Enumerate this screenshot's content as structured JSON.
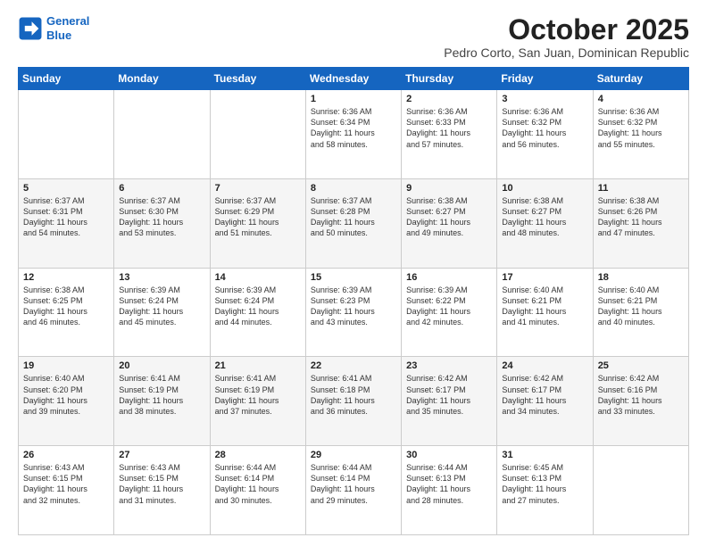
{
  "header": {
    "logo_line1": "General",
    "logo_line2": "Blue",
    "month": "October 2025",
    "location": "Pedro Corto, San Juan, Dominican Republic"
  },
  "weekdays": [
    "Sunday",
    "Monday",
    "Tuesday",
    "Wednesday",
    "Thursday",
    "Friday",
    "Saturday"
  ],
  "weeks": [
    [
      {
        "day": "",
        "info": ""
      },
      {
        "day": "",
        "info": ""
      },
      {
        "day": "",
        "info": ""
      },
      {
        "day": "1",
        "info": "Sunrise: 6:36 AM\nSunset: 6:34 PM\nDaylight: 11 hours\nand 58 minutes."
      },
      {
        "day": "2",
        "info": "Sunrise: 6:36 AM\nSunset: 6:33 PM\nDaylight: 11 hours\nand 57 minutes."
      },
      {
        "day": "3",
        "info": "Sunrise: 6:36 AM\nSunset: 6:32 PM\nDaylight: 11 hours\nand 56 minutes."
      },
      {
        "day": "4",
        "info": "Sunrise: 6:36 AM\nSunset: 6:32 PM\nDaylight: 11 hours\nand 55 minutes."
      }
    ],
    [
      {
        "day": "5",
        "info": "Sunrise: 6:37 AM\nSunset: 6:31 PM\nDaylight: 11 hours\nand 54 minutes."
      },
      {
        "day": "6",
        "info": "Sunrise: 6:37 AM\nSunset: 6:30 PM\nDaylight: 11 hours\nand 53 minutes."
      },
      {
        "day": "7",
        "info": "Sunrise: 6:37 AM\nSunset: 6:29 PM\nDaylight: 11 hours\nand 51 minutes."
      },
      {
        "day": "8",
        "info": "Sunrise: 6:37 AM\nSunset: 6:28 PM\nDaylight: 11 hours\nand 50 minutes."
      },
      {
        "day": "9",
        "info": "Sunrise: 6:38 AM\nSunset: 6:27 PM\nDaylight: 11 hours\nand 49 minutes."
      },
      {
        "day": "10",
        "info": "Sunrise: 6:38 AM\nSunset: 6:27 PM\nDaylight: 11 hours\nand 48 minutes."
      },
      {
        "day": "11",
        "info": "Sunrise: 6:38 AM\nSunset: 6:26 PM\nDaylight: 11 hours\nand 47 minutes."
      }
    ],
    [
      {
        "day": "12",
        "info": "Sunrise: 6:38 AM\nSunset: 6:25 PM\nDaylight: 11 hours\nand 46 minutes."
      },
      {
        "day": "13",
        "info": "Sunrise: 6:39 AM\nSunset: 6:24 PM\nDaylight: 11 hours\nand 45 minutes."
      },
      {
        "day": "14",
        "info": "Sunrise: 6:39 AM\nSunset: 6:24 PM\nDaylight: 11 hours\nand 44 minutes."
      },
      {
        "day": "15",
        "info": "Sunrise: 6:39 AM\nSunset: 6:23 PM\nDaylight: 11 hours\nand 43 minutes."
      },
      {
        "day": "16",
        "info": "Sunrise: 6:39 AM\nSunset: 6:22 PM\nDaylight: 11 hours\nand 42 minutes."
      },
      {
        "day": "17",
        "info": "Sunrise: 6:40 AM\nSunset: 6:21 PM\nDaylight: 11 hours\nand 41 minutes."
      },
      {
        "day": "18",
        "info": "Sunrise: 6:40 AM\nSunset: 6:21 PM\nDaylight: 11 hours\nand 40 minutes."
      }
    ],
    [
      {
        "day": "19",
        "info": "Sunrise: 6:40 AM\nSunset: 6:20 PM\nDaylight: 11 hours\nand 39 minutes."
      },
      {
        "day": "20",
        "info": "Sunrise: 6:41 AM\nSunset: 6:19 PM\nDaylight: 11 hours\nand 38 minutes."
      },
      {
        "day": "21",
        "info": "Sunrise: 6:41 AM\nSunset: 6:19 PM\nDaylight: 11 hours\nand 37 minutes."
      },
      {
        "day": "22",
        "info": "Sunrise: 6:41 AM\nSunset: 6:18 PM\nDaylight: 11 hours\nand 36 minutes."
      },
      {
        "day": "23",
        "info": "Sunrise: 6:42 AM\nSunset: 6:17 PM\nDaylight: 11 hours\nand 35 minutes."
      },
      {
        "day": "24",
        "info": "Sunrise: 6:42 AM\nSunset: 6:17 PM\nDaylight: 11 hours\nand 34 minutes."
      },
      {
        "day": "25",
        "info": "Sunrise: 6:42 AM\nSunset: 6:16 PM\nDaylight: 11 hours\nand 33 minutes."
      }
    ],
    [
      {
        "day": "26",
        "info": "Sunrise: 6:43 AM\nSunset: 6:15 PM\nDaylight: 11 hours\nand 32 minutes."
      },
      {
        "day": "27",
        "info": "Sunrise: 6:43 AM\nSunset: 6:15 PM\nDaylight: 11 hours\nand 31 minutes."
      },
      {
        "day": "28",
        "info": "Sunrise: 6:44 AM\nSunset: 6:14 PM\nDaylight: 11 hours\nand 30 minutes."
      },
      {
        "day": "29",
        "info": "Sunrise: 6:44 AM\nSunset: 6:14 PM\nDaylight: 11 hours\nand 29 minutes."
      },
      {
        "day": "30",
        "info": "Sunrise: 6:44 AM\nSunset: 6:13 PM\nDaylight: 11 hours\nand 28 minutes."
      },
      {
        "day": "31",
        "info": "Sunrise: 6:45 AM\nSunset: 6:13 PM\nDaylight: 11 hours\nand 27 minutes."
      },
      {
        "day": "",
        "info": ""
      }
    ]
  ]
}
